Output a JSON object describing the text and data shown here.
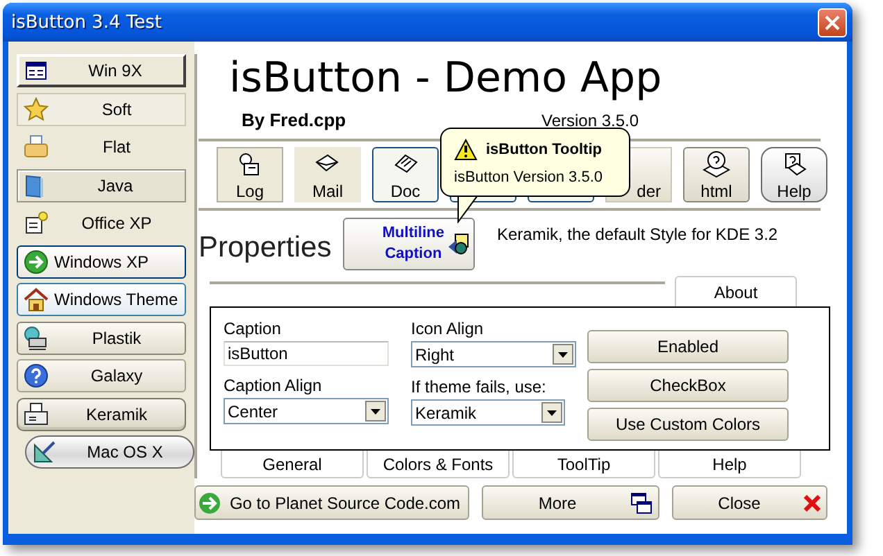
{
  "window": {
    "title": "isButton 3.4 Test"
  },
  "sidebar": {
    "items": [
      {
        "label": "Win 9X",
        "kind": "win9x"
      },
      {
        "label": "Soft",
        "kind": "soft"
      },
      {
        "label": "Flat",
        "kind": "flat"
      },
      {
        "label": "Java",
        "kind": "java"
      },
      {
        "label": "Office XP",
        "kind": "officexp"
      },
      {
        "label": "Windows XP",
        "kind": "winxp"
      },
      {
        "label": "Windows Theme",
        "kind": "wintheme"
      },
      {
        "label": "Plastik",
        "kind": "plastik"
      },
      {
        "label": "Galaxy",
        "kind": "galaxy"
      },
      {
        "label": "Keramik",
        "kind": "keramik"
      },
      {
        "label": "Mac OS X",
        "kind": "macosx"
      }
    ]
  },
  "header": {
    "title": "isButton - Demo App",
    "author": "By Fred.cpp",
    "version": "Version 3.5.0"
  },
  "toolbar": [
    {
      "label": "Log",
      "kind": "log"
    },
    {
      "label": "Mail",
      "kind": "mail"
    },
    {
      "label": "Doc",
      "kind": "doc"
    },
    {
      "kind": "covered"
    },
    {
      "kind": "covered"
    },
    {
      "label": "der",
      "kind": "folder"
    },
    {
      "label": "html",
      "kind": "html"
    },
    {
      "label": "Help",
      "kind": "help"
    }
  ],
  "tooltip": {
    "title": "isButton Tooltip",
    "text": "isButton Version 3.5.0"
  },
  "properties": {
    "heading": "Properties",
    "sample_button": [
      "Multiline",
      "Caption"
    ],
    "description": "Keramik, the default Style for KDE 3.2"
  },
  "tabs_top": [
    {
      "label": "About"
    }
  ],
  "panel": {
    "fields": [
      {
        "label": "Caption",
        "kind": "text",
        "value": "isButton"
      },
      {
        "label": "Caption Align",
        "kind": "select",
        "value": "Center"
      },
      {
        "label": "Icon Align",
        "kind": "select",
        "value": "Right"
      },
      {
        "label": "If theme fails, use:",
        "kind": "select",
        "value": "Keramik"
      }
    ],
    "buttons": [
      "Enabled",
      "CheckBox",
      "Use Custom Colors"
    ]
  },
  "tabs_bottom": [
    {
      "label": "General"
    },
    {
      "label": "Colors & Fonts"
    },
    {
      "label": "ToolTip"
    },
    {
      "label": "Help"
    }
  ],
  "footer_buttons": [
    {
      "label": "Go to Planet Source Code.com",
      "kind": "link"
    },
    {
      "label": "More",
      "kind": "more"
    },
    {
      "label": "Close",
      "kind": "close"
    }
  ]
}
